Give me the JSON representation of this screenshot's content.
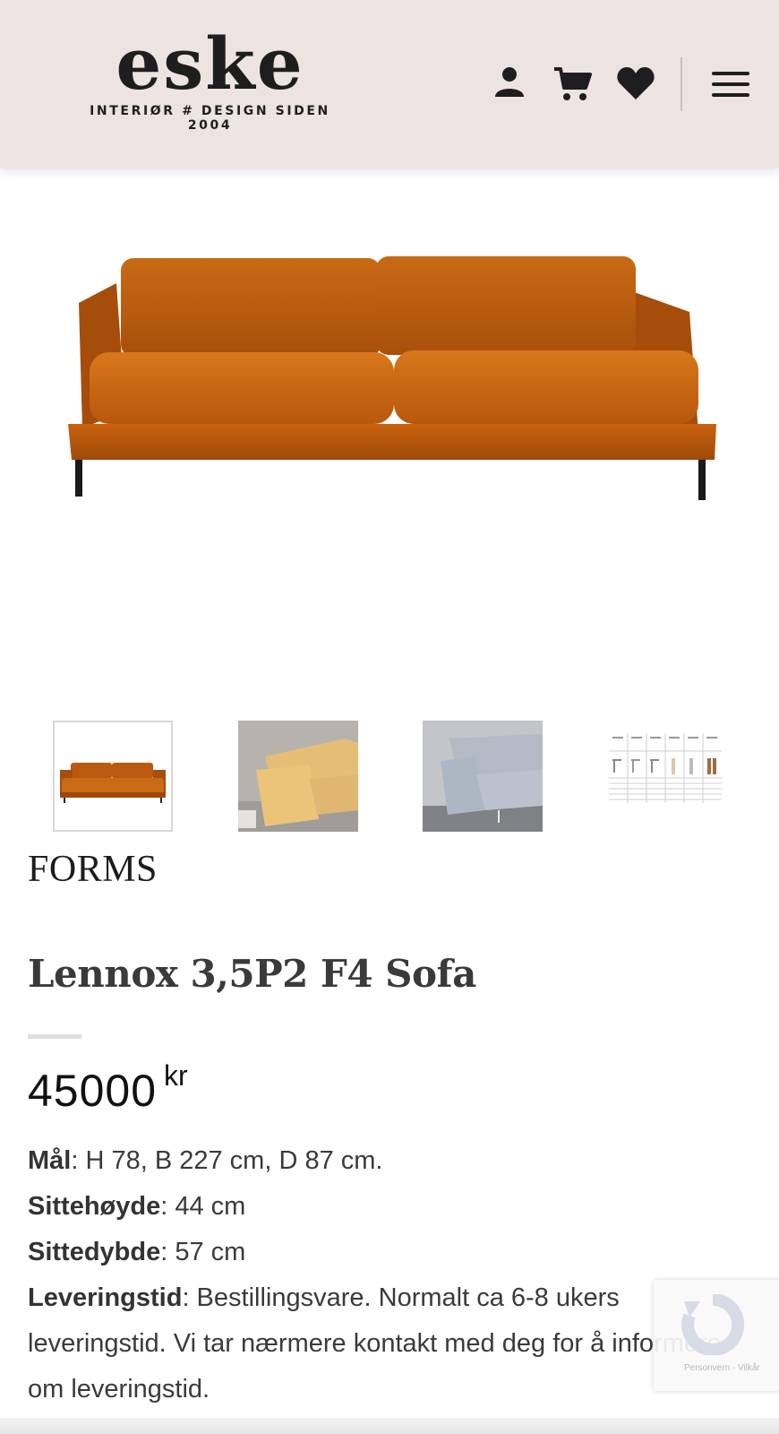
{
  "header": {
    "logo_word": "eske",
    "logo_tagline": "INTERIØR # DESIGN SIDEN 2004",
    "icons": [
      "account-icon",
      "cart-icon",
      "wishlist-heart-icon",
      "menu-hamburger-icon"
    ]
  },
  "gallery": {
    "main_image": "orange-velvet-sofa",
    "thumbnails": [
      {
        "name": "thumbnail-orange-sofa-front",
        "active": true
      },
      {
        "name": "thumbnail-mustard-sofa-side",
        "active": false
      },
      {
        "name": "thumbnail-grey-sofa-side",
        "active": false
      },
      {
        "name": "thumbnail-leg-options-chart",
        "active": false
      }
    ]
  },
  "product": {
    "brand": "FORMS",
    "title": "Lennox 3,5P2 F4 Sofa",
    "price": "45000",
    "currency": "kr",
    "specs": {
      "dimensions_label": "Mål",
      "dimensions_value": ": H 78, B 227 cm, D 87 cm.",
      "seat_height_label": "Sittehøyde",
      "seat_height_value": ": 44 cm",
      "seat_depth_label": "Sittedybde",
      "seat_depth_value": ": 57 cm",
      "delivery_label": "Leveringstid",
      "delivery_value": ": Bestillingsvare. Normalt ca 6-8 ukers leveringstid. Vi tar nærmere kontakt med deg for å informere om leveringstid."
    }
  },
  "recaptcha": {
    "legal": "Personvern - Vilkår"
  },
  "colors": {
    "header_bg": "#ede3e1",
    "sofa_orange": "#c25d0f",
    "text_dark": "#2b2b2b"
  }
}
